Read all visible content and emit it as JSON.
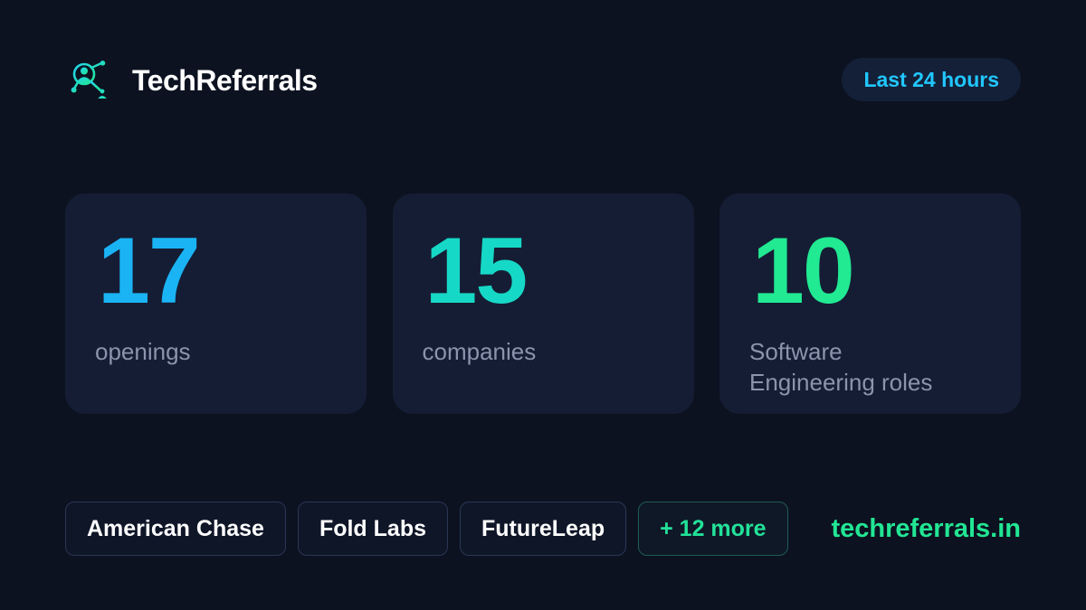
{
  "header": {
    "brand": "TechReferrals",
    "logo_icon": "referral-network-icon",
    "time_range": "Last 24 hours"
  },
  "stats": [
    {
      "value": "17",
      "label": "openings",
      "color": "#1ab4f5"
    },
    {
      "value": "15",
      "label": "companies",
      "color": "#16d8c6"
    },
    {
      "value": "10",
      "label": "Software\nEngineering roles",
      "color": "#21ea92"
    }
  ],
  "companies": [
    "American Chase",
    "Fold Labs",
    "FutureLeap"
  ],
  "more_label": "+ 12 more",
  "site": "techreferrals.in",
  "colors": {
    "background": "#0c1220",
    "card": "#151d34",
    "accent_blue": "#21c7ff",
    "accent_green": "#22e694",
    "muted_text": "#8a94ad"
  }
}
